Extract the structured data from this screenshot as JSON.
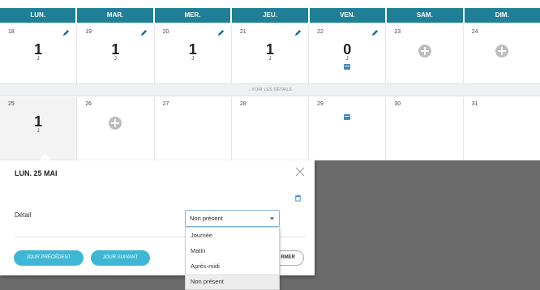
{
  "header": {
    "days": [
      "LUN.",
      "MAR.",
      "MER.",
      "JEU.",
      "VEN.",
      "SAM.",
      "DIM."
    ]
  },
  "week1": [
    {
      "day": "18",
      "value": "1",
      "unit": "J"
    },
    {
      "day": "19",
      "value": "1",
      "unit": "J"
    },
    {
      "day": "20",
      "value": "1",
      "unit": "J"
    },
    {
      "day": "21",
      "value": "1",
      "unit": "J"
    },
    {
      "day": "22",
      "value": "0",
      "unit": "J"
    },
    {
      "day": "23"
    },
    {
      "day": "24"
    }
  ],
  "details_link": "VOIR LES DÉTAILS",
  "week2": [
    {
      "day": "25",
      "value": "1",
      "unit": "J"
    },
    {
      "day": "26"
    },
    {
      "day": "27"
    },
    {
      "day": "28"
    },
    {
      "day": "29"
    },
    {
      "day": "30"
    },
    {
      "day": "31"
    }
  ],
  "popup": {
    "title": "LUN. 25 MAI",
    "detail_label": "Détail",
    "prev_button": "JOUR PRÉCÉDENT",
    "next_button": "JOUR SUIVANT",
    "confirm_button": "RMER"
  },
  "select": {
    "value": "Non présent",
    "options": [
      "Journée",
      "Matin",
      "Après-midi",
      "Non présent"
    ]
  },
  "colors": {
    "header": "#1e7f96",
    "button": "#3eb7d4",
    "overlay": "#6b6b6b"
  }
}
